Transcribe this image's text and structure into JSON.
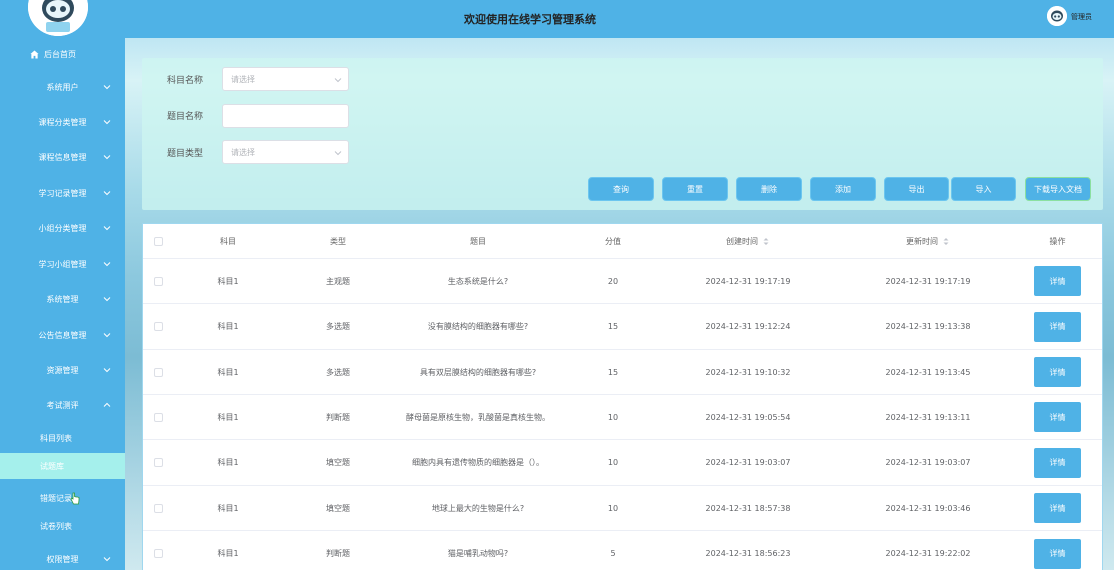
{
  "header": {
    "title": "欢迎使用在线学习管理系统",
    "username": "管理员"
  },
  "sidebar": {
    "home_label": "后台首页",
    "menu": [
      {
        "label": "系统用户",
        "expanded": false
      },
      {
        "label": "课程分类管理",
        "expanded": false
      },
      {
        "label": "课程信息管理",
        "expanded": false
      },
      {
        "label": "学习记录管理",
        "expanded": false
      },
      {
        "label": "小组分类管理",
        "expanded": false
      },
      {
        "label": "学习小组管理",
        "expanded": false
      },
      {
        "label": "系统管理",
        "expanded": false
      },
      {
        "label": "公告信息管理",
        "expanded": false
      },
      {
        "label": "资源管理",
        "expanded": false
      },
      {
        "label": "考试测评",
        "expanded": true
      }
    ],
    "sub_items": [
      {
        "label": "科目列表",
        "active": false
      },
      {
        "label": "试题库",
        "active": true
      },
      {
        "label": "错题记录",
        "active": false
      },
      {
        "label": "试卷列表",
        "active": false
      }
    ],
    "last_menu": {
      "label": "权限管理"
    }
  },
  "search": {
    "subject_label": "科目名称",
    "subject_placeholder": "请选择",
    "question_label": "题目名称",
    "question_value": "",
    "type_label": "题目类型",
    "type_placeholder": "请选择"
  },
  "buttons": {
    "query": "查询",
    "reset": "重置",
    "delete": "删除",
    "add": "添加",
    "export": "导出",
    "import": "导入",
    "download_template": "下载导入文档"
  },
  "table": {
    "columns": [
      "科目",
      "类型",
      "题目",
      "分值",
      "创建时间",
      "更新时间",
      "操作"
    ],
    "detail_label": "详情",
    "rows": [
      {
        "subject": "科目1",
        "type": "主观题",
        "question": "生态系统是什么?",
        "score": "20",
        "created": "2024-12-31 19:17:19",
        "updated": "2024-12-31 19:17:19"
      },
      {
        "subject": "科目1",
        "type": "多选题",
        "question": "没有膜结构的细胞器有哪些?",
        "score": "15",
        "created": "2024-12-31 19:12:24",
        "updated": "2024-12-31 19:13:38"
      },
      {
        "subject": "科目1",
        "type": "多选题",
        "question": "具有双层膜结构的细胞器有哪些?",
        "score": "15",
        "created": "2024-12-31 19:10:32",
        "updated": "2024-12-31 19:13:45"
      },
      {
        "subject": "科目1",
        "type": "判断题",
        "question": "酵母菌是原核生物，乳酸菌是真核生物。",
        "score": "10",
        "created": "2024-12-31 19:05:54",
        "updated": "2024-12-31 19:13:11"
      },
      {
        "subject": "科目1",
        "type": "填空题",
        "question": "细胞内具有遗传物质的细胞器是（）。",
        "score": "10",
        "created": "2024-12-31 19:03:07",
        "updated": "2024-12-31 19:03:07"
      },
      {
        "subject": "科目1",
        "type": "填空题",
        "question": "地球上最大的生物是什么?",
        "score": "10",
        "created": "2024-12-31 18:57:38",
        "updated": "2024-12-31 19:03:46"
      },
      {
        "subject": "科目1",
        "type": "判断题",
        "question": "猫是哺乳动物吗?",
        "score": "5",
        "created": "2024-12-31 18:56:23",
        "updated": "2024-12-31 19:22:02"
      }
    ]
  }
}
